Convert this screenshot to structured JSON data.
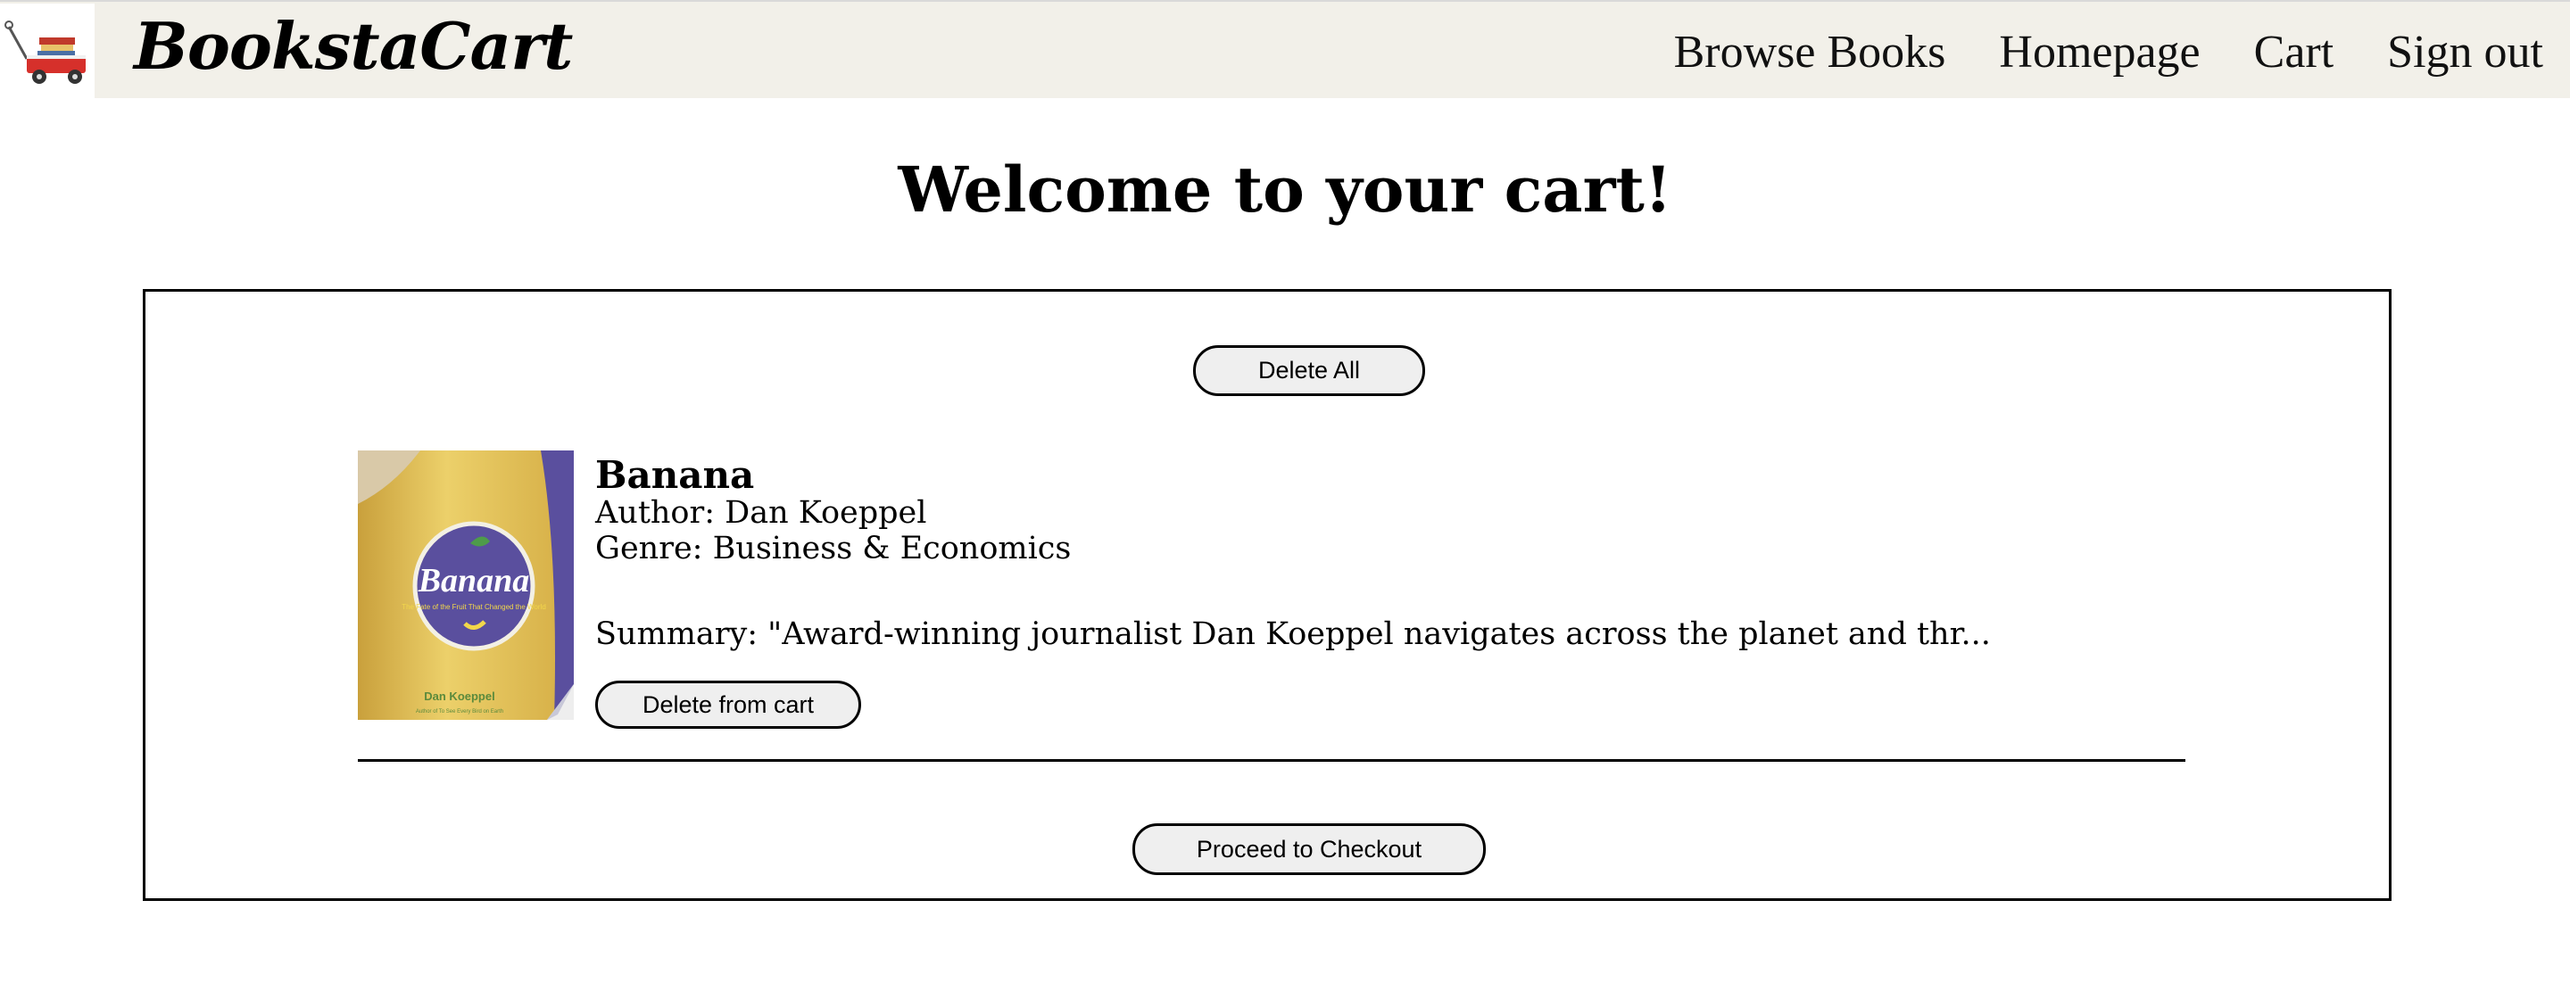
{
  "header": {
    "logo_icon": "wagon-with-books-icon",
    "brand": "BookstaCart",
    "nav": [
      "Browse Books",
      "Homepage",
      "Cart",
      "Sign out"
    ]
  },
  "page": {
    "title": "Welcome to your cart!"
  },
  "cart": {
    "delete_all_label": "Delete All",
    "items": [
      {
        "title": "Banana",
        "author": "Author: Dan Koeppel",
        "genre": "Genre: Business & Economics",
        "summary": "Summary: \"Award-winning journalist Dan Koeppel navigates across the planet and thr...",
        "delete_label": "Delete from cart",
        "cover": {
          "title": "Banana",
          "subtitle": "The Fate of the Fruit That Changed the World",
          "author": "Dan Koeppel",
          "tagline": "Author of To See Every Bird on Earth"
        }
      }
    ],
    "checkout_label": "Proceed to Checkout"
  },
  "colors": {
    "navbar_bg": "#f2f0e9",
    "button_bg": "#efefef",
    "cover_purple": "#5a4f9e",
    "cover_yellow": "#e9c75b"
  }
}
